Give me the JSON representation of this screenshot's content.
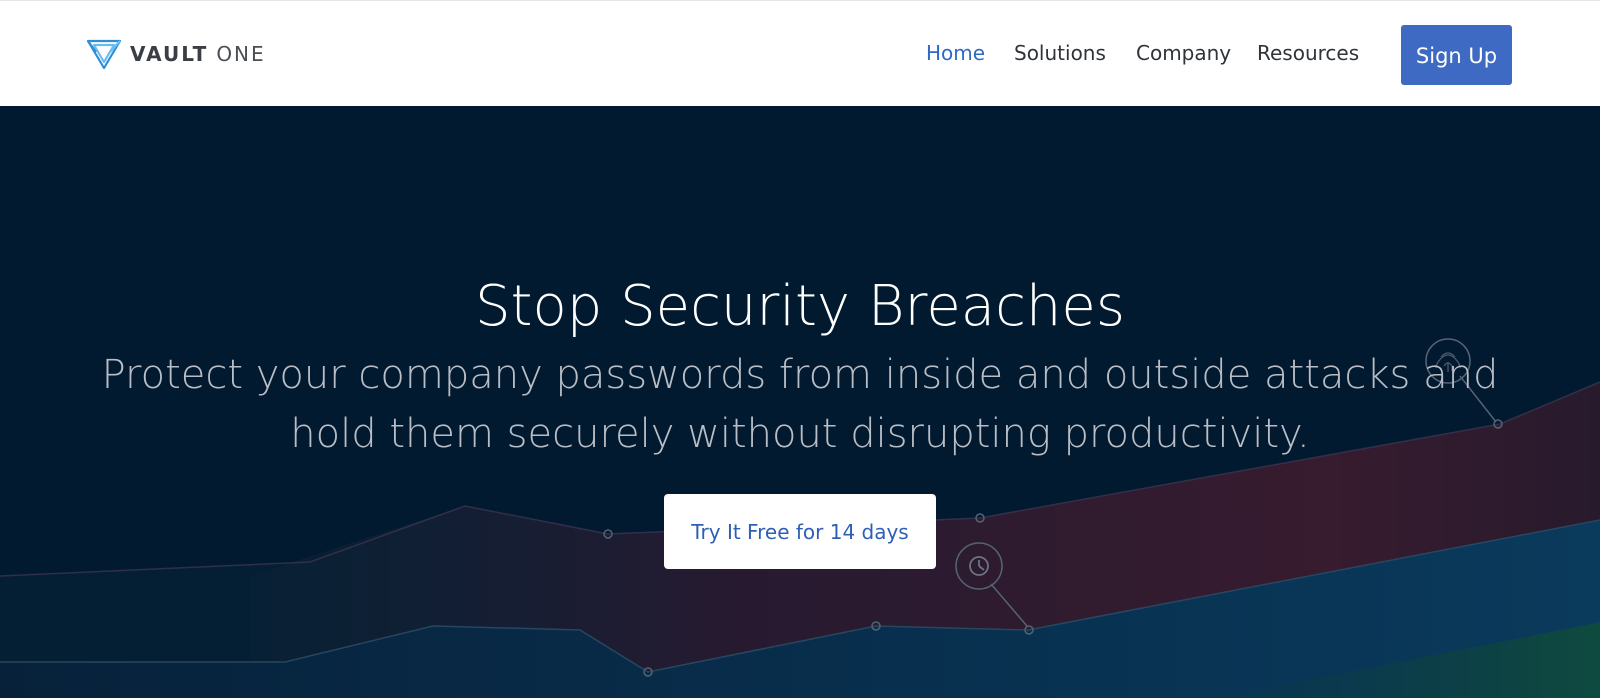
{
  "brand": {
    "name_bold": "VAULT",
    "name_light": "ONE",
    "icon": "vault-one-logo-icon",
    "color": "#2f8fd6"
  },
  "nav": {
    "items": [
      {
        "label": "Home",
        "active": true
      },
      {
        "label": "Solutions",
        "active": false
      },
      {
        "label": "Company",
        "active": false
      },
      {
        "label": "Resources",
        "active": false
      }
    ],
    "signup_label": "Sign Up",
    "accent": "#3f6ac4",
    "active_color": "#2f68c7"
  },
  "hero": {
    "title": "Stop Security Breaches",
    "subtitle": "Protect your company passwords from inside and outside attacks and hold them securely without disrupting productivity.",
    "cta_label": "Try It Free for 14 days",
    "background_color": "#021a2f",
    "decorative_icons": [
      "fingerprint-icon",
      "clock-icon"
    ]
  }
}
